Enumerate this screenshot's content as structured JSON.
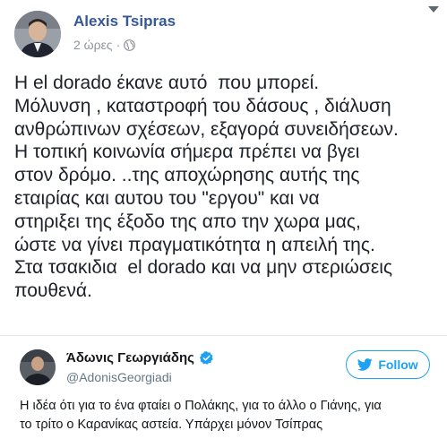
{
  "facebook_post": {
    "author": "Alexis Tsipras",
    "time": "2 ώρες",
    "separator": "·",
    "body_lines": [
      "Η el dorado έκανε αυτό  που μπορεί.",
      "Μόλυνση , καταστροφή του δάσους , διάλυση",
      "ανθρώπινων σχέσεων, εξαγορά συνειδήσεων.",
      "Η τοπική κοινωνία σήμερα πρέπει να βγει",
      "στον δρόμο. ..της αποχώρησης αυτής της",
      "εταιρίας και αυτου του \"εργου\" και να",
      "στηριξει της έξοδο της απο την χωρα μας,",
      "ώστε να γίνει πραγματικότητα η απειλή της.",
      "Στα τσακιδια  el dorado και να μην στεριώσεις",
      "πουθενά."
    ]
  },
  "tweet": {
    "author": "Άδωνις Γεωργιάδης",
    "handle": "@AdonisGeorgiadi",
    "follow_label": "Follow",
    "text_lines": [
      "Η ιδέα ότι για το ένα φταίει ο Πολάκης, για το άλλο ο Γιάνης, για",
      "το τρίτο ο Καρανίκας αστεία. Υπάρχει μόνον Τσίπρας"
    ]
  },
  "colors": {
    "fb_link": "#365899",
    "twitter_blue": "#1da1f2",
    "verified_blue": "#1da1f2"
  },
  "icons": {
    "globe": "globe-icon",
    "chevron": "chevron-down-icon",
    "verified": "verified-badge-icon",
    "bird": "twitter-bird-icon"
  }
}
